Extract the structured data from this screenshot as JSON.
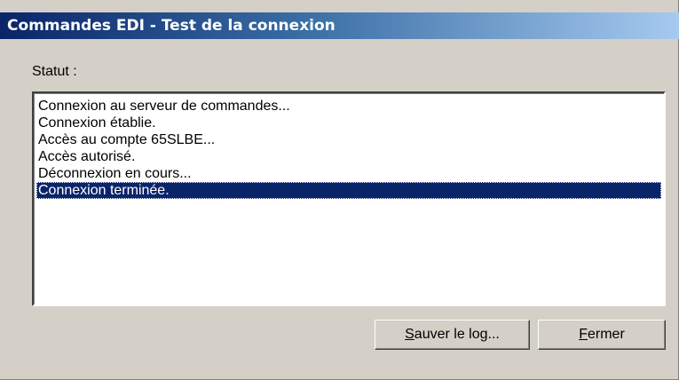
{
  "window": {
    "title": "Commandes EDI - Test de la connexion"
  },
  "status": {
    "label": "Statut :"
  },
  "log": {
    "items": [
      "Connexion au serveur de commandes...",
      "Connexion établie.",
      "Accès au compte 65SLBE...",
      "Accès autorisé.",
      "Déconnexion en cours...",
      "Connexion terminée."
    ],
    "selected_index": 5
  },
  "buttons": {
    "save": {
      "mnemonic": "S",
      "rest": "auver le log..."
    },
    "close": {
      "mnemonic": "F",
      "rest": "ermer"
    }
  },
  "colors": {
    "titlebar_start": "#0a246a",
    "titlebar_end": "#a6caf0",
    "selection": "#0a246a",
    "face": "#d4d0c8"
  }
}
